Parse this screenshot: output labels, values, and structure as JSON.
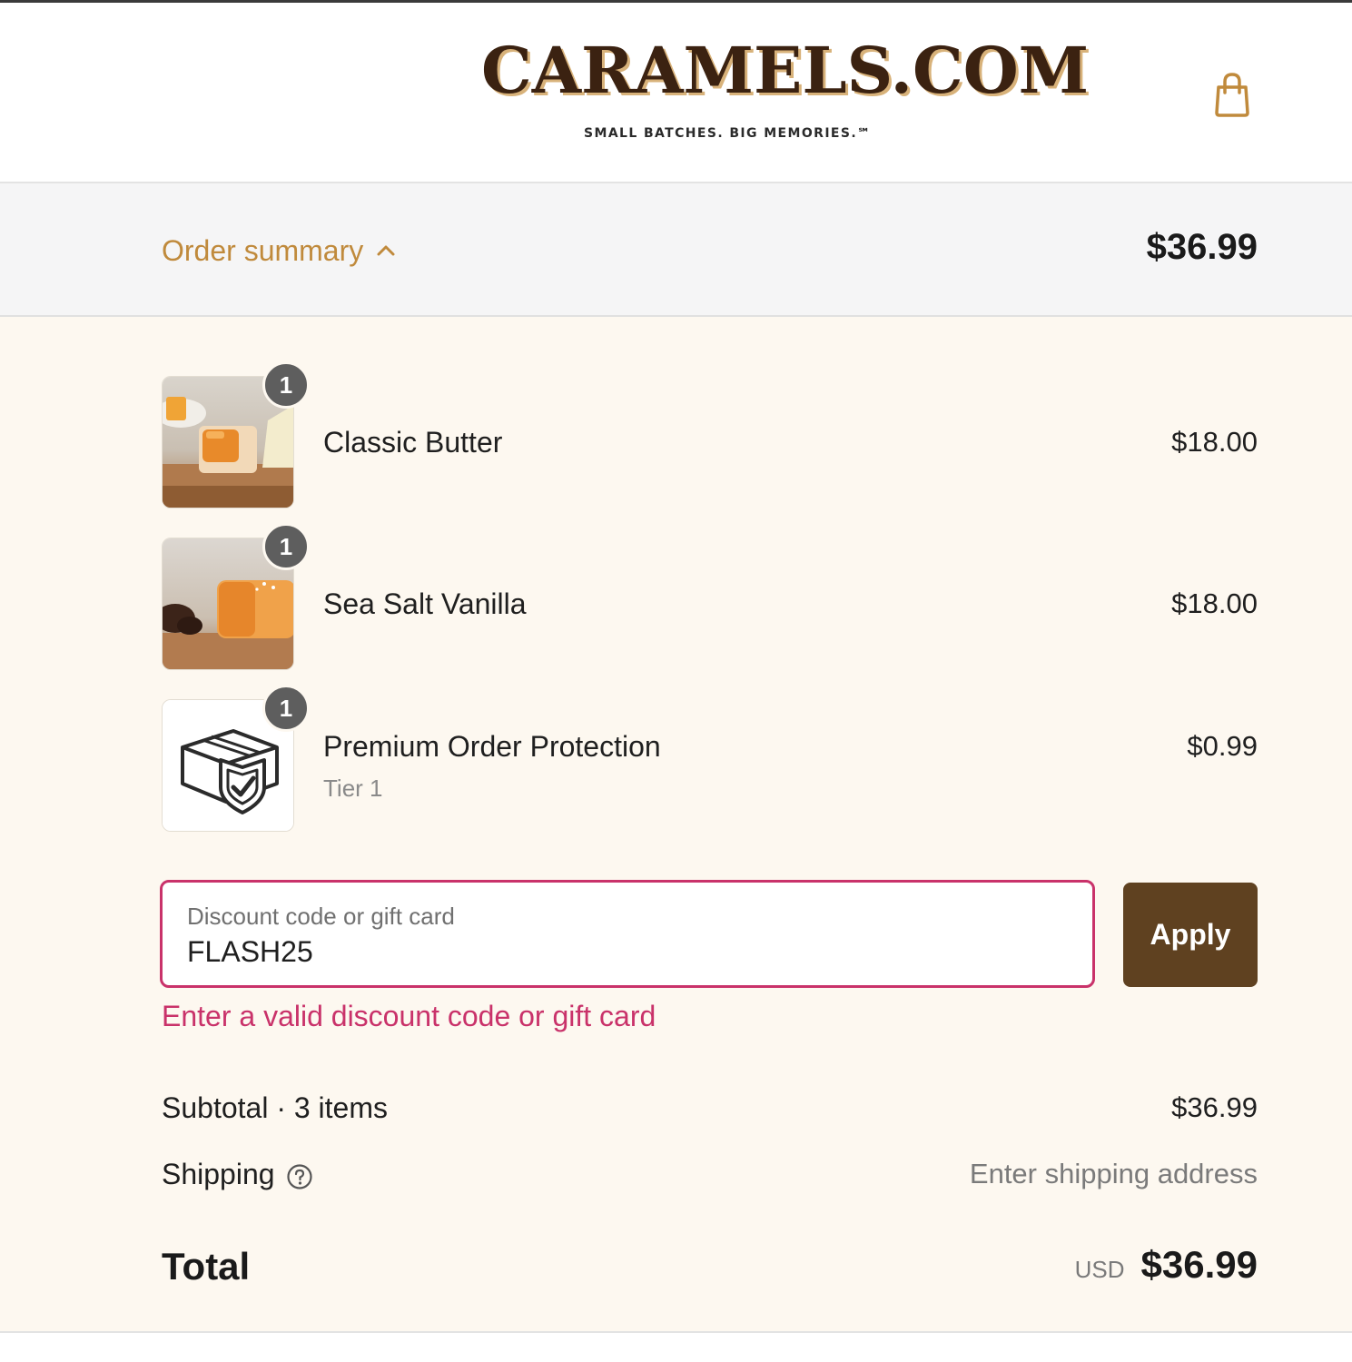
{
  "header": {
    "logo_text": "CARAMELS.COM",
    "logo_tagline": "SMALL BATCHES. BIG MEMORIES.℠",
    "cart_icon": "shopping-bag-icon"
  },
  "summary": {
    "toggle_label": "Order summary",
    "toggle_icon": "chevron-up-icon",
    "total": "$36.99"
  },
  "items": [
    {
      "name": "Classic Butter",
      "subtitle": "",
      "price": "$18.00",
      "quantity": "1",
      "image": "caramel-photo"
    },
    {
      "name": "Sea Salt Vanilla",
      "subtitle": "",
      "price": "$18.00",
      "quantity": "1",
      "image": "caramel-photo"
    },
    {
      "name": "Premium Order Protection",
      "subtitle": "Tier 1",
      "price": "$0.99",
      "quantity": "1",
      "image": "package-shield-icon"
    }
  ],
  "discount": {
    "label": "Discount code or gift card",
    "value": "FLASH25",
    "apply_label": "Apply",
    "error": "Enter a valid discount code or gift card"
  },
  "totals": {
    "subtotal_label": "Subtotal · 3 items",
    "subtotal_value": "$36.99",
    "shipping_label": "Shipping",
    "shipping_value": "Enter shipping address",
    "total_label": "Total",
    "currency": "USD",
    "total_value": "$36.99"
  },
  "colors": {
    "accent": "#c08a3c",
    "button": "#5f4120",
    "error": "#c9326a",
    "panel_bg": "#fdf8f0",
    "summary_bg": "#f5f5f6"
  }
}
